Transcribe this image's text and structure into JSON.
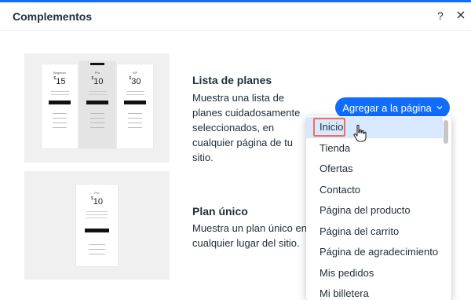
{
  "header": {
    "title": "Complementos",
    "help_label": "?"
  },
  "sections": [
    {
      "title": "Lista de planes",
      "description": "Muestra una lista de planes cuidadosamente seleccionados, en cualquier página de tu sitio."
    },
    {
      "title": "Plan único",
      "description": "Muestra un plan único en cualquier lugar del sitio."
    }
  ],
  "thumbnails": {
    "list": [
      {
        "name": "Beginner",
        "price": "15",
        "symbol": "$"
      },
      {
        "name": "Pro",
        "price": "10",
        "symbol": "$"
      },
      {
        "name": "VIP",
        "price": "30",
        "symbol": "$"
      }
    ],
    "single": {
      "name": "Pro",
      "price": "10",
      "symbol": "$"
    }
  },
  "add_button": {
    "label": "Agregar a la página",
    "color": "#116dff"
  },
  "dropdown": {
    "items": [
      "Inicio",
      "Tienda",
      "Ofertas",
      "Contacto",
      "Página del producto",
      "Página del carrito",
      "Página de agradecimiento",
      "Mis pedidos",
      "Mi billetera"
    ],
    "selected": "Inicio",
    "highlight_color": "#f06f5b"
  }
}
